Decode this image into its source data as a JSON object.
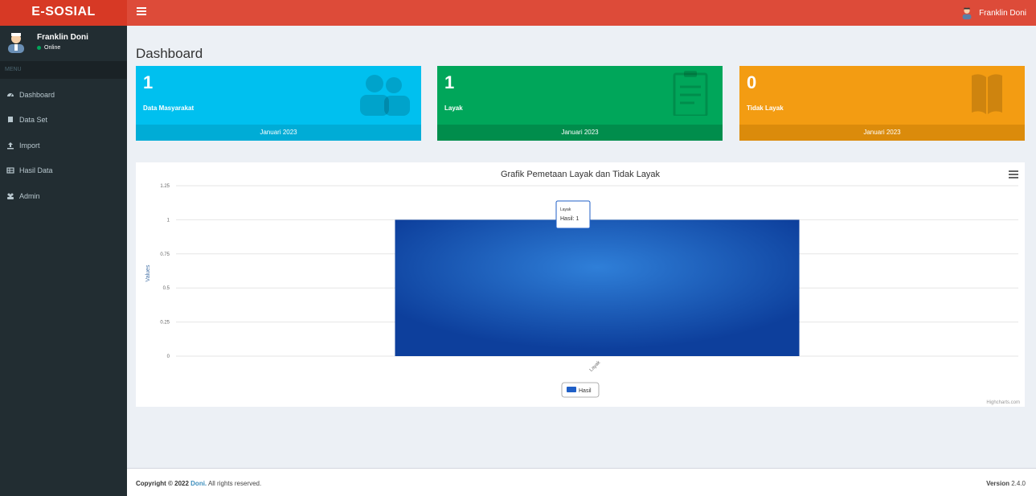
{
  "app": {
    "logo": "E-SOSIAL"
  },
  "header": {
    "user_name": "Franklin Doni"
  },
  "sidebar": {
    "user_name": "Franklin Doni",
    "status": "Online",
    "menu_header": "MENU",
    "items": [
      {
        "label": "Dashboard",
        "icon": "dashboard-icon"
      },
      {
        "label": "Data Set",
        "icon": "book-icon"
      },
      {
        "label": "Import",
        "icon": "upload-icon"
      },
      {
        "label": "Hasil Data",
        "icon": "table-icon"
      },
      {
        "label": "Admin",
        "icon": "users-icon"
      }
    ]
  },
  "page": {
    "title": "Dashboard"
  },
  "boxes": [
    {
      "value": "1",
      "label": "Data Masyarakat",
      "footer": "Januari 2023",
      "color": "#00c0ef",
      "icon": "users-icon"
    },
    {
      "value": "1",
      "label": "Layak",
      "footer": "Januari 2023",
      "color": "#00a65a",
      "icon": "clipboard-icon"
    },
    {
      "value": "0",
      "label": "Tidak Layak",
      "footer": "Januari 2023",
      "color": "#f39c12",
      "icon": "book-open-icon"
    }
  ],
  "chart_data": {
    "type": "bar",
    "title": "Grafik Pemetaan Layak dan Tidak Layak",
    "ylabel": "Values",
    "categories": [
      "Layak"
    ],
    "series": [
      {
        "name": "Hasil",
        "values": [
          1
        ],
        "color": "#1f5fc7"
      }
    ],
    "ylim": [
      0,
      1.25
    ],
    "yticks": [
      "0",
      "0.25",
      "0.5",
      "0.75",
      "1",
      "1.25"
    ],
    "grid": true,
    "legend": "bottom-center",
    "tooltip": {
      "category": "Layak",
      "text": "Hasil: 1"
    },
    "credit": "Highcharts.com"
  },
  "footer": {
    "copyright_prefix": "Copyright © 2022",
    "author": "Doni.",
    "rights": "All rights reserved.",
    "version_label": "Version",
    "version_value": "2.4.0"
  }
}
